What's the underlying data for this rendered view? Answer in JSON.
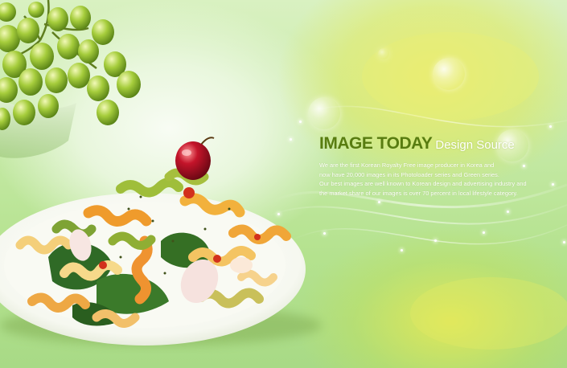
{
  "headline": {
    "brand": "IMAGE TODAY",
    "tagline": "Design Source"
  },
  "body_lines": [
    "We are the first Korean Royalty Free image producer in Korea and",
    "now have 20,000 images in its Photoloader series and Green series.",
    "Our best images are well known to Korean design and advertising industry and",
    "the market share of our images is over 70 percent in local lifestyle category."
  ],
  "colors": {
    "background": "#c7eaa8",
    "brand_text": "#587c10",
    "tagline_text": "#ffffff",
    "highlight_yellow": "#e6ea6c"
  },
  "scene": {
    "subject": "pasta-salad-with-grapes",
    "elements": [
      "green-grapes",
      "fusilli-pasta-plate",
      "cherry",
      "leafy-greens",
      "bokeh-bubbles",
      "light-waves"
    ]
  }
}
